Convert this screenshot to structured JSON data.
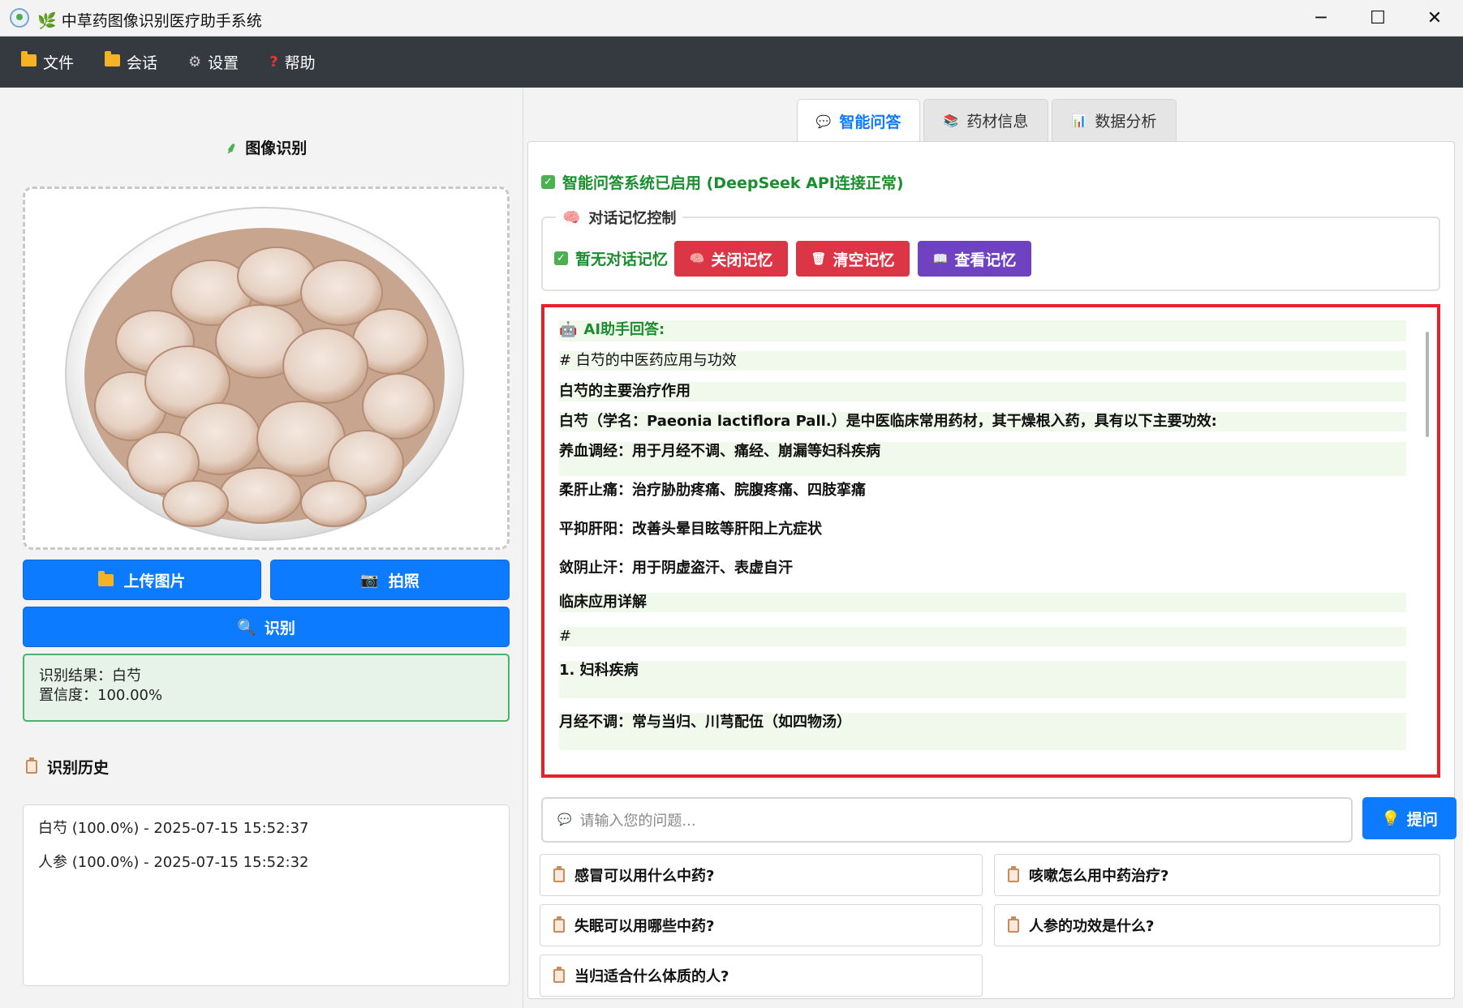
{
  "window": {
    "title": "🌿 中草药图像识别医疗助手系统",
    "minimize": "─",
    "maximize": "☐",
    "close": "✕"
  },
  "menu": [
    {
      "icon": "folder-icon",
      "label": "文件"
    },
    {
      "icon": "folder-open-icon",
      "label": "会话"
    },
    {
      "icon": "gear-icon",
      "label": "设置"
    },
    {
      "icon": "question-icon",
      "label": "帮助"
    }
  ],
  "left": {
    "image_section_title": "图像识别",
    "upload_label": "上传图片",
    "camera_label": "拍照",
    "recognize_label": "识别",
    "result_line1": "识别结果：白芍",
    "result_line2": "置信度：100.00%",
    "history_title": "识别历史",
    "history": [
      "白芍 (100.0%) - 2025-07-15 15:52:37",
      "人参 (100.0%) - 2025-07-15 15:52:32"
    ]
  },
  "tabs": [
    {
      "icon": "speech-bubble-icon",
      "label": "智能问答",
      "active": true
    },
    {
      "icon": "books-icon",
      "label": "药材信息",
      "active": false
    },
    {
      "icon": "bar-chart-icon",
      "label": "数据分析",
      "active": false
    }
  ],
  "qa": {
    "status": "智能问答系统已启用 (DeepSeek API连接正常)",
    "memory_group_title": "对话记忆控制",
    "memory_status": "暂无对话记忆",
    "close_memory": "关闭记忆",
    "clear_memory": "清空记忆",
    "view_memory": "查看记忆",
    "answer_header": "AI助手回答:",
    "answer_lines": [
      "# 白芍的中医药应用与功效",
      "白芍的主要治疗作用",
      "白芍（学名：Paeonia lactiflora Pall.）是中医临床常用药材，其干燥根入药，具有以下主要功效:",
      "养血调经：用于月经不调、痛经、崩漏等妇科疾病",
      "柔肝止痛：治疗胁肋疼痛、脘腹疼痛、四肢挛痛",
      "平抑肝阳：改善头晕目眩等肝阳上亢症状",
      "敛阴止汗：用于阴虚盗汗、表虚自汗",
      "临床应用详解",
      "#",
      "1. 妇科疾病",
      "月经不调：常与当归、川芎配伍（如四物汤）"
    ],
    "input_placeholder": "请输入您的问题...",
    "ask_label": "提问",
    "quick_questions": [
      "感冒可以用什么中药?",
      "咳嗽怎么用中药治疗?",
      "失眠可以用哪些中药?",
      "人参的功效是什么?",
      "当归适合什么体质的人?"
    ]
  },
  "colors": {
    "accent": "#0d7bff",
    "menubar": "#343a40",
    "success": "#1a8d2e",
    "danger": "#dc3545",
    "purple": "#6f42c1",
    "highlight_border": "#e8202a"
  }
}
